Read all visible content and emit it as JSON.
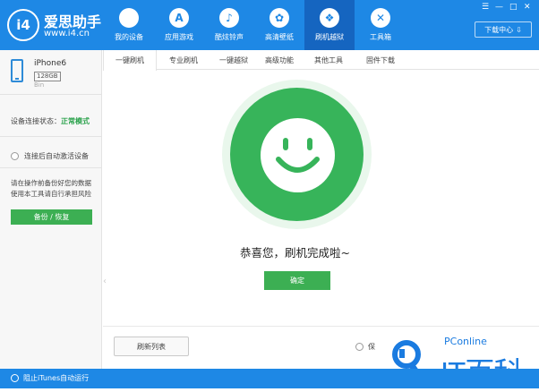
{
  "app": {
    "name": "爱思助手",
    "url": "www.i4.cn",
    "logo_mark": "i4"
  },
  "nav": {
    "items": [
      {
        "label": "我的设备",
        "icon": "apple-icon",
        "glyph": ""
      },
      {
        "label": "应用游戏",
        "icon": "app-store-icon",
        "glyph": "A"
      },
      {
        "label": "酷炫铃声",
        "icon": "bell-icon",
        "glyph": "♪"
      },
      {
        "label": "高清壁纸",
        "icon": "flower-icon",
        "glyph": "✿"
      },
      {
        "label": "刷机越狱",
        "icon": "dropbox-icon",
        "glyph": "❖"
      },
      {
        "label": "工具箱",
        "icon": "tools-icon",
        "glyph": "✕"
      }
    ],
    "active_index": 4
  },
  "window": {
    "download_center": "下载中心",
    "controls": [
      "☰",
      "—",
      "□",
      "✕"
    ]
  },
  "device": {
    "name": "iPhone6",
    "capacity": "128GB",
    "version": "Bin",
    "connection_label": "设备连接状态：",
    "connection_value": "正常模式",
    "auto_activate": "连接后自动激活设备",
    "warning": "请在操作前备份好您的数据 使用本工具请自行承担风险",
    "backup_button": "备份 / 恢复"
  },
  "tabs": [
    "一键刷机",
    "专业刷机",
    "一键越狱",
    "高级功能",
    "其他工具",
    "固件下载"
  ],
  "main": {
    "success_message": "恭喜您，刷机完成啦~",
    "confirm_button": "确定",
    "refresh_list_button": "刷新列表",
    "keep_data_partial": "保"
  },
  "statusbar": {
    "itunes_label": "阻止iTunes自动运行"
  },
  "watermark": {
    "brand": "PConline",
    "name": "IT百科"
  },
  "colors": {
    "primary": "#1E88E5",
    "primary_dark": "#1565C0",
    "success": "#37B45A",
    "button_green": "#3CAF53"
  }
}
